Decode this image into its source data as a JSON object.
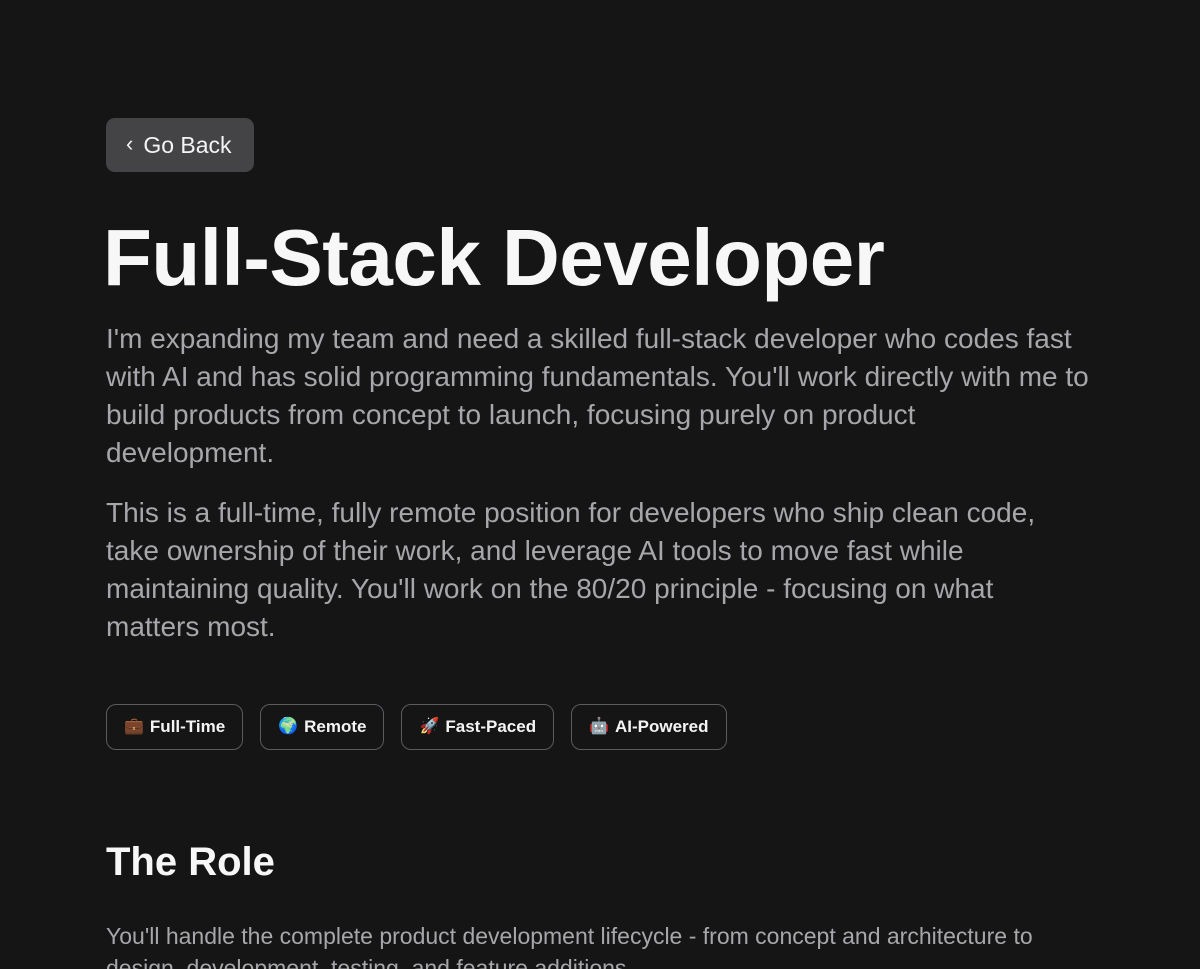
{
  "nav": {
    "back_label": "Go Back",
    "back_icon": "chevron-left-icon"
  },
  "header": {
    "title": "Full-Stack Developer",
    "paragraphs": [
      "I'm expanding my team and need a skilled full-stack developer who codes fast with AI and has solid programming fundamentals. You'll work directly with me to build products from concept to launch, focusing purely on product development.",
      "This is a full-time, fully remote position for developers who ship clean code, take ownership of their work, and leverage AI tools to move fast while maintaining quality. You'll work on the 80/20 principle - focusing on what matters most."
    ]
  },
  "tags": [
    {
      "icon": "💼",
      "icon_name": "briefcase-icon",
      "label": "Full-Time"
    },
    {
      "icon": "🌍",
      "icon_name": "globe-icon",
      "label": "Remote"
    },
    {
      "icon": "🚀",
      "icon_name": "rocket-icon",
      "label": "Fast-Paced"
    },
    {
      "icon": "🤖",
      "icon_name": "robot-icon",
      "label": "AI-Powered"
    }
  ],
  "role": {
    "heading": "The Role",
    "text": "You'll handle the complete product development lifecycle - from concept and architecture to design, development, testing, and feature additions."
  },
  "colors": {
    "background": "#151516",
    "button_bg": "#444446",
    "text_primary": "#f4f4f5",
    "text_secondary": "#a7a7ab",
    "tag_border": "#5b5b60"
  }
}
